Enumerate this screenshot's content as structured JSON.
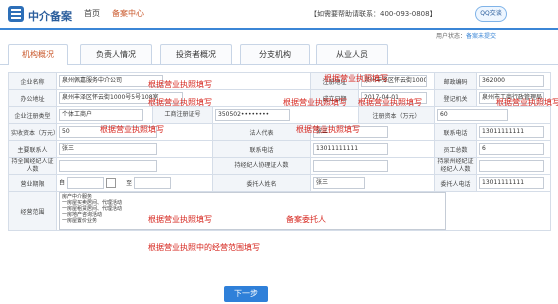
{
  "header": {
    "brand": "中介备案",
    "nav": [
      "首页",
      "备案中心"
    ],
    "hotline": "【如需要帮助请联系：400-093-0808】",
    "qq_label": "QQ交谈"
  },
  "user_status": {
    "label": "用户状态：",
    "value": "备案未提交"
  },
  "tabs": [
    "机构概况",
    "负责人情况",
    "投资者概况",
    "分支机构",
    "从业人员"
  ],
  "form": {
    "company_name_label": "企业名称",
    "company_name": "泉州佩嘉服务中介公司",
    "reg_address_label": "注册地址",
    "reg_address": "泉州丰泽区怀云街1000号",
    "postcode_label": "邮政编码",
    "postcode": "362000",
    "office_address_label": "办公地址",
    "office_address": "泉州丰泽区怀云街1000号5号108室",
    "found_date_label": "成立日期",
    "found_date": "2017-04-01",
    "reg_authority_label": "登记机关",
    "reg_authority": "泉州市工商行政管理局",
    "enterprise_type_label": "企业注册类型",
    "enterprise_type": "个体工商户",
    "reg_number_label": "工商注册证号",
    "reg_number": "350502••••••••",
    "reg_capital_label": "注册资本（万元）",
    "reg_capital": "60",
    "paid_capital_label": "实收资本（万元）",
    "paid_capital": "50",
    "legal_rep_label": "法人代表",
    "legal_rep": "张三",
    "contact_phone_label": "联系电话",
    "contact_phone": "13011111111",
    "main_contact_label": "主要联系人",
    "main_contact": "张三",
    "phone_label": "联系电话",
    "phone": "13011111111",
    "staff_count_label": "员工总数",
    "staff_count": "6",
    "certified_broker_label": "持全国经纪人证人数",
    "certified_broker": "",
    "assoc_broker_label": "持经纪人协理证人数",
    "assoc_broker": "",
    "province_cert_label": "持泉州经纪证经纪人人数",
    "province_cert": "",
    "term_label": "营业期限",
    "term_from_prefix": "自",
    "term_to_prefix": "至",
    "agent_name_label": "委托人姓名",
    "agent_name": "张三",
    "agent_phone_label": "委托人电话",
    "agent_phone": "13011111111",
    "scope_label": "经营范围",
    "scope_text": "房产中介服务\n一房屋买卖居间、代理活动\n一房屋租赁居间、代理活动\n一房地产咨询活动\n一房屋置价业务"
  },
  "notes": {
    "n1": "根据营业执照填写",
    "n2": "根据营业执照填写",
    "n3": "根据营业执照填写",
    "n4": "根据营业执照填写",
    "n5": "根据营业执照填写",
    "n6": "根据营业执照填写",
    "n7": "根据营业执照填写",
    "n8": "根据营业执照填写",
    "n9": "根据营业执照填写",
    "n10": "备案委托人",
    "n11": "根据营业执照中的经营范围填写"
  },
  "next_button": "下一步",
  "colors": {
    "accent": "#2f80d9",
    "note": "#d6241c",
    "active_tab": "#c9572a"
  }
}
